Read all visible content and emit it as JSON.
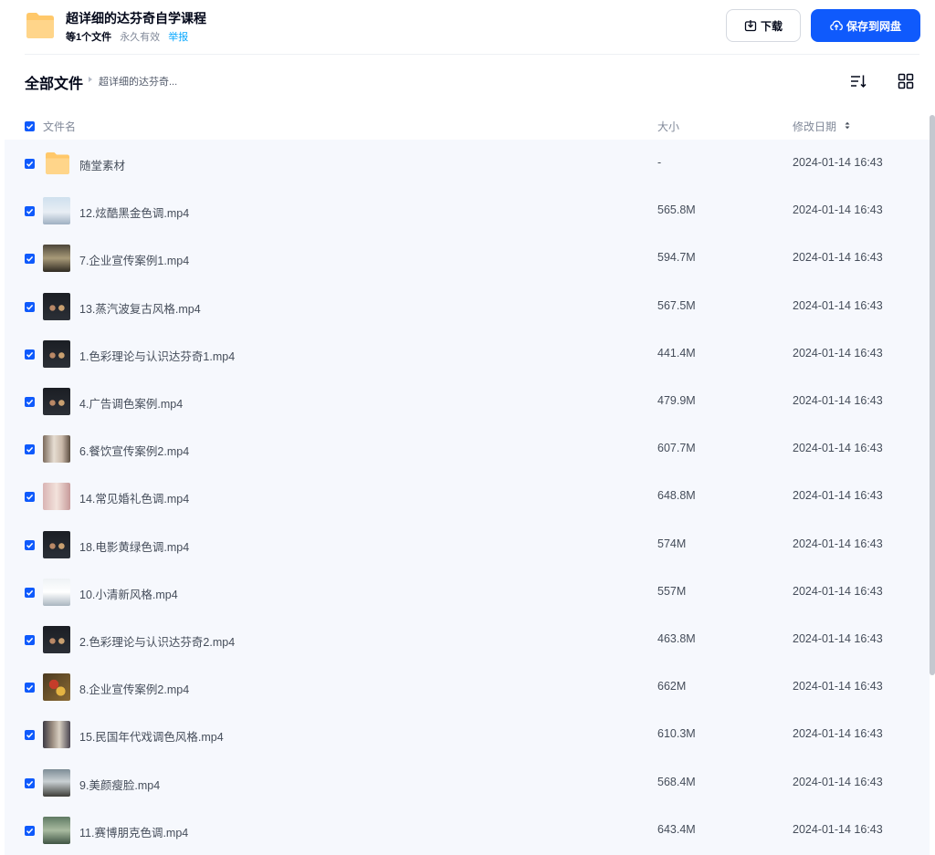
{
  "header": {
    "title": "超详细的达芬奇自学课程",
    "file_count": "等1个文件",
    "validity": "永久有效",
    "report_label": "举报",
    "download_label": "下载",
    "save_label": "保存到网盘"
  },
  "breadcrumb": {
    "root": "全部文件",
    "current": "超详细的达芬奇..."
  },
  "table": {
    "columns": {
      "name": "文件名",
      "size": "大小",
      "date": "修改日期"
    },
    "rows": [
      {
        "name": "随堂素材",
        "size": "-",
        "date": "2024-01-14 16:43",
        "type": "folder",
        "checked": true
      },
      {
        "name": "12.炫酷黑金色调.mp4",
        "size": "565.8M",
        "date": "2024-01-14 16:43",
        "type": "video",
        "checked": true,
        "thumb": "light"
      },
      {
        "name": "7.企业宣传案例1.mp4",
        "size": "594.7M",
        "date": "2024-01-14 16:43",
        "type": "video",
        "checked": true,
        "thumb": "room"
      },
      {
        "name": "13.蒸汽波复古风格.mp4",
        "size": "567.5M",
        "date": "2024-01-14 16:43",
        "type": "video",
        "checked": true,
        "thumb": "dark"
      },
      {
        "name": "1.色彩理论与认识达芬奇1.mp4",
        "size": "441.4M",
        "date": "2024-01-14 16:43",
        "type": "video",
        "checked": true,
        "thumb": "dark"
      },
      {
        "name": "4.广告调色案例.mp4",
        "size": "479.9M",
        "date": "2024-01-14 16:43",
        "type": "video",
        "checked": true,
        "thumb": "dark"
      },
      {
        "name": "6.餐饮宣传案例2.mp4",
        "size": "607.7M",
        "date": "2024-01-14 16:43",
        "type": "video",
        "checked": true,
        "thumb": "people"
      },
      {
        "name": "14.常见婚礼色调.mp4",
        "size": "648.8M",
        "date": "2024-01-14 16:43",
        "type": "video",
        "checked": true,
        "thumb": "pink"
      },
      {
        "name": "18.电影黄绿色调.mp4",
        "size": "574M",
        "date": "2024-01-14 16:43",
        "type": "video",
        "checked": true,
        "thumb": "dark"
      },
      {
        "name": "10.小清新风格.mp4",
        "size": "557M",
        "date": "2024-01-14 16:43",
        "type": "video",
        "checked": true,
        "thumb": "white"
      },
      {
        "name": "2.色彩理论与认识达芬奇2.mp4",
        "size": "463.8M",
        "date": "2024-01-14 16:43",
        "type": "video",
        "checked": true,
        "thumb": "dark"
      },
      {
        "name": "8.企业宣传案例2.mp4",
        "size": "662M",
        "date": "2024-01-14 16:43",
        "type": "video",
        "checked": true,
        "thumb": "food"
      },
      {
        "name": "15.民国年代戏调色风格.mp4",
        "size": "610.3M",
        "date": "2024-01-14 16:43",
        "type": "video",
        "checked": true,
        "thumb": "vintage"
      },
      {
        "name": "9.美颜瘦脸.mp4",
        "size": "568.4M",
        "date": "2024-01-14 16:43",
        "type": "video",
        "checked": true,
        "thumb": "outdoor"
      },
      {
        "name": "11.赛博朋克色调.mp4",
        "size": "643.4M",
        "date": "2024-01-14 16:43",
        "type": "video",
        "checked": true,
        "thumb": "green"
      }
    ]
  },
  "icons": {
    "folder": "folder-icon",
    "download": "download-icon",
    "cloud_upload": "cloud-upload-icon",
    "sort": "sort-icon",
    "grid": "grid-view-icon",
    "checkbox": "checkbox-checked-icon",
    "sort_arrow": "sort-arrow-icon"
  },
  "colors": {
    "primary": "#0f5afc",
    "link": "#06a7ff",
    "folder": "#ffc86a",
    "list_bg": "#f6f8fd",
    "text_muted": "#818999"
  }
}
